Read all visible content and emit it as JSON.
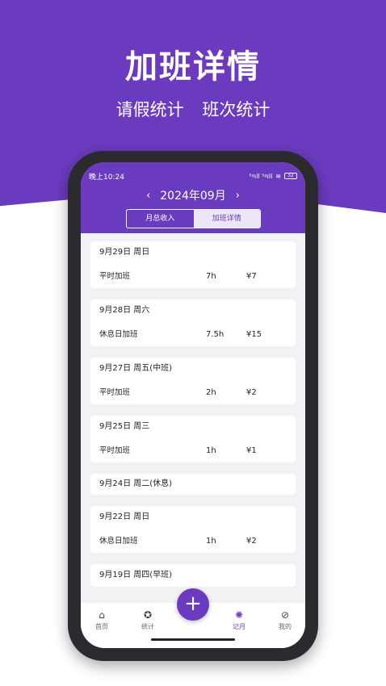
{
  "promo": {
    "title": "加班详情",
    "subtitle_left": "请假统计",
    "subtitle_right": "班次统计"
  },
  "status": {
    "time": "晚上10:24",
    "signal": "⁵ᵍıll ⁵ᵍıll",
    "battery": "32"
  },
  "header": {
    "month": "2024年09月",
    "prev": "‹",
    "next": "›"
  },
  "segment": {
    "left": "月总收入",
    "right": "加班详情",
    "selected": "right"
  },
  "records": [
    {
      "date": "9月29日 周日",
      "type": "平时加班",
      "hours": "7h",
      "money": "¥7"
    },
    {
      "date": "9月28日 周六",
      "type": "休息日加班",
      "hours": "7.5h",
      "money": "¥15"
    },
    {
      "date": "9月27日 周五(中班)",
      "type": "平时加班",
      "hours": "2h",
      "money": "¥2"
    },
    {
      "date": "9月25日 周三",
      "type": "平时加班",
      "hours": "1h",
      "money": "¥1"
    },
    {
      "date": "9月24日 周二(休息)"
    },
    {
      "date": "9月22日 周日",
      "type": "休息日加班",
      "hours": "1h",
      "money": "¥2"
    },
    {
      "date": "9月19日 周四(早班)"
    }
  ],
  "tabs": [
    {
      "label": "首页",
      "icon": "home-icon"
    },
    {
      "label": "统计",
      "icon": "star-icon"
    },
    {
      "label": "记月",
      "icon": "aperture-icon"
    },
    {
      "label": "我的",
      "icon": "compass-icon"
    }
  ],
  "fab_label": "+",
  "colors": {
    "accent": "#6a3bbf"
  }
}
